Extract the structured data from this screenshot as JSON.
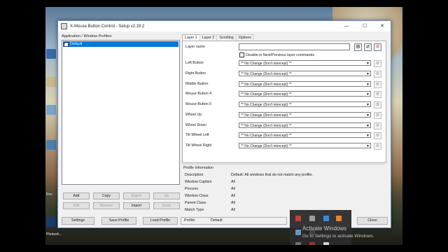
{
  "window": {
    "title": "X-Mouse Button Control - Setup v2.19.2",
    "min": "—",
    "max": "☐",
    "close": "✕"
  },
  "profiles": {
    "header": "Application / Window Profiles:",
    "items": [
      {
        "label": "Default",
        "checked": true
      }
    ],
    "buttons": {
      "add": "Add",
      "copy": "Copy",
      "export": "Export",
      "up": "Up",
      "edit": "Edit",
      "remove": "Remove",
      "import": "Import",
      "down": "Down"
    }
  },
  "tabs": [
    "Layer 1",
    "Layer 2",
    "Scrolling",
    "Options"
  ],
  "layer": {
    "name_label": "Layer name",
    "name_value": "",
    "disable_label": "Disable in Next/Previous layer commands",
    "rows": [
      {
        "label": "Left Button",
        "value": "** No Change (Don't intercept) **"
      },
      {
        "label": "Right Button",
        "value": "** No Change (Don't intercept) **"
      },
      {
        "label": "Middle Button",
        "value": "** No Change (Don't intercept) **"
      },
      {
        "label": "Mouse Button 4",
        "value": "** No Change (Don't intercept) **"
      },
      {
        "label": "Mouse Button 5",
        "value": "** No Change (Don't intercept) **"
      },
      {
        "label": "Wheel Up",
        "value": "** No Change (Don't intercept) **"
      },
      {
        "label": "Wheel Down",
        "value": "** No Change (Don't intercept) **"
      },
      {
        "label": "Tilt Wheel Left",
        "value": "** No Change (Don't intercept) **"
      },
      {
        "label": "Tilt Wheel Right",
        "value": "** No Change (Don't intercept) **"
      }
    ]
  },
  "info": {
    "title": "Profile Information",
    "rows": [
      {
        "label": "Description",
        "value": "Default: All windows that do not match any profile."
      },
      {
        "label": "Window Caption",
        "value": "All"
      },
      {
        "label": "Process",
        "value": "All"
      },
      {
        "label": "Window Class",
        "value": "All"
      },
      {
        "label": "Parent Class",
        "value": "All"
      },
      {
        "label": "Match Type",
        "value": "All"
      }
    ]
  },
  "footer": {
    "settings": "Settings",
    "save_profile": "Save Profile",
    "load_profile": "Load Profile",
    "profile_label": "Profile:",
    "profile_value": "Default",
    "close": "Close"
  },
  "desktop": {
    "labels": [
      "Rec",
      "Photosh..."
    ],
    "watermark_title": "Activate Windows",
    "watermark_sub": "Go to Settings to activate Windows."
  }
}
